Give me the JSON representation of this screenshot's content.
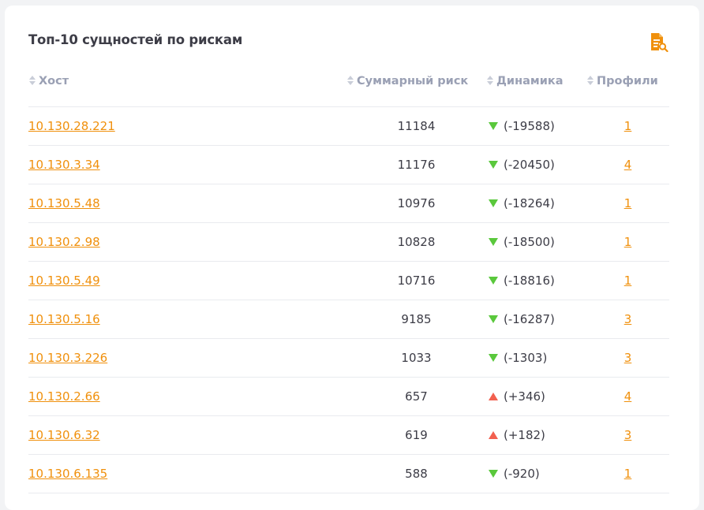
{
  "widget": {
    "title": "Топ-10 сущностей по рискам",
    "report_icon": "document-search-icon",
    "accent_color": "#f0900c"
  },
  "table": {
    "columns": {
      "host": "Хост",
      "risk": "Суммарный риск",
      "dynamics": "Динамика",
      "profiles": "Профили"
    },
    "rows": [
      {
        "host": "10.130.28.221",
        "risk": "11184",
        "trend": "down",
        "dynamics": "(-19588)",
        "profiles": "1"
      },
      {
        "host": "10.130.3.34",
        "risk": "11176",
        "trend": "down",
        "dynamics": "(-20450)",
        "profiles": "4"
      },
      {
        "host": "10.130.5.48",
        "risk": "10976",
        "trend": "down",
        "dynamics": "(-18264)",
        "profiles": "1"
      },
      {
        "host": "10.130.2.98",
        "risk": "10828",
        "trend": "down",
        "dynamics": "(-18500)",
        "profiles": "1"
      },
      {
        "host": "10.130.5.49",
        "risk": "10716",
        "trend": "down",
        "dynamics": "(-18816)",
        "profiles": "1"
      },
      {
        "host": "10.130.5.16",
        "risk": "9185",
        "trend": "down",
        "dynamics": "(-16287)",
        "profiles": "3"
      },
      {
        "host": "10.130.3.226",
        "risk": "1033",
        "trend": "down",
        "dynamics": "(-1303)",
        "profiles": "3"
      },
      {
        "host": "10.130.2.66",
        "risk": "657",
        "trend": "up",
        "dynamics": "(+346)",
        "profiles": "4"
      },
      {
        "host": "10.130.6.32",
        "risk": "619",
        "trend": "up",
        "dynamics": "(+182)",
        "profiles": "3"
      },
      {
        "host": "10.130.6.135",
        "risk": "588",
        "trend": "down",
        "dynamics": "(-920)",
        "profiles": "1"
      }
    ]
  },
  "colors": {
    "trend_down": "#5ac83c",
    "trend_up": "#f2604f",
    "header_text": "#9aa0b4"
  }
}
